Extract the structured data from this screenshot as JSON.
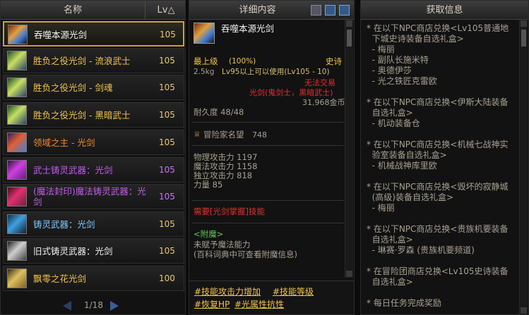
{
  "left": {
    "header": {
      "name": "名称",
      "lv": "Lv△"
    },
    "rows": [
      {
        "name": "吞噬本源光剑",
        "lv": "105",
        "color": "#f0f0f0"
      },
      {
        "name": "胜负之役光剑 - 流浪武士",
        "lv": "105",
        "color": "#f2c44a"
      },
      {
        "name": "胜负之役光剑 - 剑魂",
        "lv": "105",
        "color": "#f2c44a"
      },
      {
        "name": "胜负之役光剑 - 黑暗武士",
        "lv": "105",
        "color": "#f2c44a"
      },
      {
        "name": "领域之主 - 光剑",
        "lv": "105",
        "color": "#f08a28"
      },
      {
        "name": "武士铸灵武器：光剑",
        "lv": "105",
        "color": "#c05ce8"
      },
      {
        "name": "(魔法封印)魔法铸灵武器：光剑",
        "lv": "105",
        "color": "#c05ce8"
      },
      {
        "name": "铸灵武器：光剑",
        "lv": "105",
        "color": "#7ec8ff"
      },
      {
        "name": "旧式铸灵武器：光剑",
        "lv": "105",
        "color": "#f0f0f0"
      },
      {
        "name": "飘零之花光剑",
        "lv": "100",
        "color": "#f2c44a"
      }
    ],
    "pager": "1/18"
  },
  "mid": {
    "header": "详细内容",
    "item_name": "吞噬本源光剑",
    "grade": "最上级",
    "grade_pct": "(100%)",
    "rarity": "史诗",
    "weight": "2.5kg",
    "level_req": "Lv95以上可以使用(Lv105 - 10)",
    "trade": "无法交易",
    "type": "光剑(鬼剑士，黑暗武士)",
    "price": "31,968金币",
    "durability": "耐久度 48/48",
    "fame_label": "冒险家名望",
    "fame_value": "748",
    "stats": [
      "物理攻击力 1197",
      "魔法攻击力 1158",
      "独立攻击力 818",
      "力量 85"
    ],
    "skill_req": "需要[光剑掌握]技能",
    "enchant_title": "<附魔>",
    "enchant_line1": "未赋予魔法能力",
    "enchant_line2": "(百科词典中可查看附魔信息)",
    "tags": [
      "#技能攻击力增加",
      "#技能等级",
      "#恢复HP",
      "#光属性抗性"
    ]
  },
  "right": {
    "header": "获取信息",
    "lines": [
      "* 在以下NPC商店兑换<Lv105普通地",
      "  下城史诗装备自选礼盒>",
      "  - 梅丽",
      "  - 副队长施米特",
      "  - 奥德伊莎",
      "  - 光之铁匠克雷欧",
      "",
      "* 在以下NPC商店兑换<伊斯大陆装备",
      "  自选礼盒>",
      "  - 机动装备仓",
      "",
      "* 在以下NPC商店兑换<机械七战神实",
      "  验室装备自选礼盒>",
      "  - 机械战神库里欧",
      "",
      "* 在以下NPC商店兑换<毁坏的寂静城",
      "  (高级)装备自选礼盒>",
      "  - 梅丽",
      "",
      "* 在以下NPC商店兑换<贵族机要装备",
      "  自选礼盒>",
      "  - 琳赛·罗森 (贵族机要频道)",
      "",
      "* 在冒险团商店兑换<Lv105史诗装备",
      "  自选礼盒>",
      "",
      "* 每日任务完成奖励"
    ]
  }
}
